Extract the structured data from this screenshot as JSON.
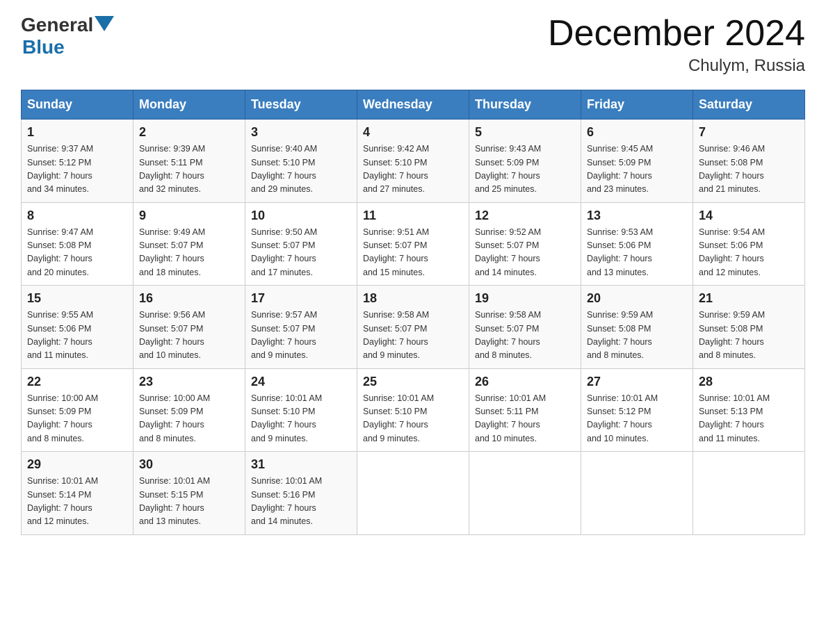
{
  "header": {
    "logo": {
      "general": "General",
      "blue": "Blue"
    },
    "title": "December 2024",
    "subtitle": "Chulym, Russia"
  },
  "columns": [
    "Sunday",
    "Monday",
    "Tuesday",
    "Wednesday",
    "Thursday",
    "Friday",
    "Saturday"
  ],
  "weeks": [
    [
      {
        "day": "1",
        "sunrise": "Sunrise: 9:37 AM",
        "sunset": "Sunset: 5:12 PM",
        "daylight": "Daylight: 7 hours",
        "minutes": "and 34 minutes."
      },
      {
        "day": "2",
        "sunrise": "Sunrise: 9:39 AM",
        "sunset": "Sunset: 5:11 PM",
        "daylight": "Daylight: 7 hours",
        "minutes": "and 32 minutes."
      },
      {
        "day": "3",
        "sunrise": "Sunrise: 9:40 AM",
        "sunset": "Sunset: 5:10 PM",
        "daylight": "Daylight: 7 hours",
        "minutes": "and 29 minutes."
      },
      {
        "day": "4",
        "sunrise": "Sunrise: 9:42 AM",
        "sunset": "Sunset: 5:10 PM",
        "daylight": "Daylight: 7 hours",
        "minutes": "and 27 minutes."
      },
      {
        "day": "5",
        "sunrise": "Sunrise: 9:43 AM",
        "sunset": "Sunset: 5:09 PM",
        "daylight": "Daylight: 7 hours",
        "minutes": "and 25 minutes."
      },
      {
        "day": "6",
        "sunrise": "Sunrise: 9:45 AM",
        "sunset": "Sunset: 5:09 PM",
        "daylight": "Daylight: 7 hours",
        "minutes": "and 23 minutes."
      },
      {
        "day": "7",
        "sunrise": "Sunrise: 9:46 AM",
        "sunset": "Sunset: 5:08 PM",
        "daylight": "Daylight: 7 hours",
        "minutes": "and 21 minutes."
      }
    ],
    [
      {
        "day": "8",
        "sunrise": "Sunrise: 9:47 AM",
        "sunset": "Sunset: 5:08 PM",
        "daylight": "Daylight: 7 hours",
        "minutes": "and 20 minutes."
      },
      {
        "day": "9",
        "sunrise": "Sunrise: 9:49 AM",
        "sunset": "Sunset: 5:07 PM",
        "daylight": "Daylight: 7 hours",
        "minutes": "and 18 minutes."
      },
      {
        "day": "10",
        "sunrise": "Sunrise: 9:50 AM",
        "sunset": "Sunset: 5:07 PM",
        "daylight": "Daylight: 7 hours",
        "minutes": "and 17 minutes."
      },
      {
        "day": "11",
        "sunrise": "Sunrise: 9:51 AM",
        "sunset": "Sunset: 5:07 PM",
        "daylight": "Daylight: 7 hours",
        "minutes": "and 15 minutes."
      },
      {
        "day": "12",
        "sunrise": "Sunrise: 9:52 AM",
        "sunset": "Sunset: 5:07 PM",
        "daylight": "Daylight: 7 hours",
        "minutes": "and 14 minutes."
      },
      {
        "day": "13",
        "sunrise": "Sunrise: 9:53 AM",
        "sunset": "Sunset: 5:06 PM",
        "daylight": "Daylight: 7 hours",
        "minutes": "and 13 minutes."
      },
      {
        "day": "14",
        "sunrise": "Sunrise: 9:54 AM",
        "sunset": "Sunset: 5:06 PM",
        "daylight": "Daylight: 7 hours",
        "minutes": "and 12 minutes."
      }
    ],
    [
      {
        "day": "15",
        "sunrise": "Sunrise: 9:55 AM",
        "sunset": "Sunset: 5:06 PM",
        "daylight": "Daylight: 7 hours",
        "minutes": "and 11 minutes."
      },
      {
        "day": "16",
        "sunrise": "Sunrise: 9:56 AM",
        "sunset": "Sunset: 5:07 PM",
        "daylight": "Daylight: 7 hours",
        "minutes": "and 10 minutes."
      },
      {
        "day": "17",
        "sunrise": "Sunrise: 9:57 AM",
        "sunset": "Sunset: 5:07 PM",
        "daylight": "Daylight: 7 hours",
        "minutes": "and 9 minutes."
      },
      {
        "day": "18",
        "sunrise": "Sunrise: 9:58 AM",
        "sunset": "Sunset: 5:07 PM",
        "daylight": "Daylight: 7 hours",
        "minutes": "and 9 minutes."
      },
      {
        "day": "19",
        "sunrise": "Sunrise: 9:58 AM",
        "sunset": "Sunset: 5:07 PM",
        "daylight": "Daylight: 7 hours",
        "minutes": "and 8 minutes."
      },
      {
        "day": "20",
        "sunrise": "Sunrise: 9:59 AM",
        "sunset": "Sunset: 5:08 PM",
        "daylight": "Daylight: 7 hours",
        "minutes": "and 8 minutes."
      },
      {
        "day": "21",
        "sunrise": "Sunrise: 9:59 AM",
        "sunset": "Sunset: 5:08 PM",
        "daylight": "Daylight: 7 hours",
        "minutes": "and 8 minutes."
      }
    ],
    [
      {
        "day": "22",
        "sunrise": "Sunrise: 10:00 AM",
        "sunset": "Sunset: 5:09 PM",
        "daylight": "Daylight: 7 hours",
        "minutes": "and 8 minutes."
      },
      {
        "day": "23",
        "sunrise": "Sunrise: 10:00 AM",
        "sunset": "Sunset: 5:09 PM",
        "daylight": "Daylight: 7 hours",
        "minutes": "and 8 minutes."
      },
      {
        "day": "24",
        "sunrise": "Sunrise: 10:01 AM",
        "sunset": "Sunset: 5:10 PM",
        "daylight": "Daylight: 7 hours",
        "minutes": "and 9 minutes."
      },
      {
        "day": "25",
        "sunrise": "Sunrise: 10:01 AM",
        "sunset": "Sunset: 5:10 PM",
        "daylight": "Daylight: 7 hours",
        "minutes": "and 9 minutes."
      },
      {
        "day": "26",
        "sunrise": "Sunrise: 10:01 AM",
        "sunset": "Sunset: 5:11 PM",
        "daylight": "Daylight: 7 hours",
        "minutes": "and 10 minutes."
      },
      {
        "day": "27",
        "sunrise": "Sunrise: 10:01 AM",
        "sunset": "Sunset: 5:12 PM",
        "daylight": "Daylight: 7 hours",
        "minutes": "and 10 minutes."
      },
      {
        "day": "28",
        "sunrise": "Sunrise: 10:01 AM",
        "sunset": "Sunset: 5:13 PM",
        "daylight": "Daylight: 7 hours",
        "minutes": "and 11 minutes."
      }
    ],
    [
      {
        "day": "29",
        "sunrise": "Sunrise: 10:01 AM",
        "sunset": "Sunset: 5:14 PM",
        "daylight": "Daylight: 7 hours",
        "minutes": "and 12 minutes."
      },
      {
        "day": "30",
        "sunrise": "Sunrise: 10:01 AM",
        "sunset": "Sunset: 5:15 PM",
        "daylight": "Daylight: 7 hours",
        "minutes": "and 13 minutes."
      },
      {
        "day": "31",
        "sunrise": "Sunrise: 10:01 AM",
        "sunset": "Sunset: 5:16 PM",
        "daylight": "Daylight: 7 hours",
        "minutes": "and 14 minutes."
      },
      null,
      null,
      null,
      null
    ]
  ]
}
